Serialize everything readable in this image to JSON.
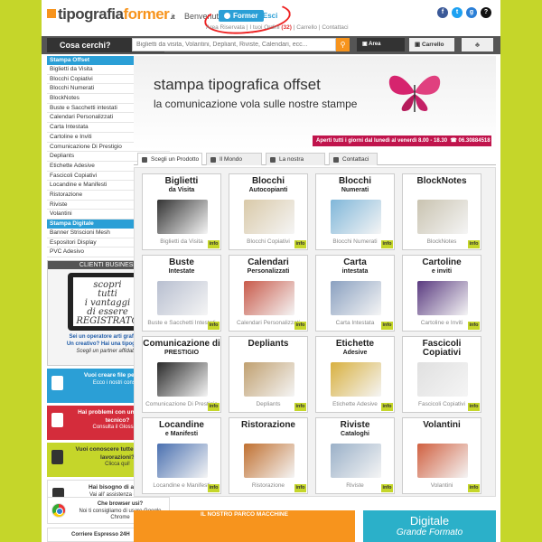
{
  "header": {
    "logo_main": "tipografia",
    "logo_accent": "former",
    "logo_tld": ".it",
    "welcome": "Benvenuto",
    "user": "Former",
    "logout": "- Esci",
    "subnav": [
      "Area Riservata",
      "I tuoi Ordini",
      "Carrello",
      "Contattaci"
    ],
    "orders_count": "(32)",
    "social": [
      {
        "name": "facebook-icon",
        "glyph": "f",
        "color": "#3b5998"
      },
      {
        "name": "twitter-icon",
        "glyph": "t",
        "color": "#1da1f2"
      },
      {
        "name": "gplus-icon",
        "glyph": "g",
        "color": "#2b7fd6"
      },
      {
        "name": "help-icon",
        "glyph": "?",
        "color": "#111111"
      }
    ]
  },
  "search": {
    "label": "Cosa cerchi?",
    "placeholder": "Biglietti da visita, Volantini, Depliant, Riviste, Calendari, ecc...",
    "area_riservata": "Area Riservata",
    "carrello": "Carrello"
  },
  "sidebar": {
    "offset_title": "Stampa Offset",
    "offset_items": [
      "Biglietti da Visita",
      "Blocchi Copiativi",
      "Blocchi Numerati",
      "BlockNotes",
      "Buste e Sacchetti intestati",
      "Calendari Personalizzati",
      "Carta Intestata",
      "Cartoline e Inviti",
      "Comunicazione Di Prestigio",
      "Depliants",
      "Etichette Adesive",
      "Fascicoli Copiativi",
      "Locandine e Manifesti",
      "Ristorazione",
      "Riviste",
      "Volantini"
    ],
    "digital_title": "Stampa Digitale",
    "digital_items": [
      "Banner Striscioni Mesh",
      "Espositori Display",
      "PVC Adesivo"
    ],
    "clienti": {
      "title": "CLIENTI BUSINESS",
      "tablet_text": [
        "scopri",
        "tutti",
        "i vantaggi",
        "di essere",
        "REGISTRATO"
      ],
      "text1": "Sei un operatore arti grafiche?",
      "text2": "Un creativo? Hai una tipografia?",
      "text3": "Scegli un partner affidabile"
    },
    "boxes": [
      {
        "name": "file-box",
        "title": "Vuoi creare file perfetti?",
        "sub": "Ecco i nostri consigli",
        "bg": "#2b9fd6",
        "icon_bg": "#ffffff"
      },
      {
        "name": "glossary-box",
        "title": "Hai problemi con un termine tecnico?",
        "sub": "Consulta il Glossario",
        "bg": "#d42c3b",
        "icon_bg": "#ffffff"
      },
      {
        "name": "processing-box",
        "title": "Vuoi conoscere tutte le nostre lavorazioni?",
        "sub": "Clicca qui!",
        "bg": "#c5d62a",
        "icon_bg": "#333333"
      },
      {
        "name": "assistance-box",
        "title": "Hai bisogno di aiuto?",
        "sub": "Vai all' assistenza clienti",
        "bg": "#ffffff",
        "icon_bg": "#333333"
      }
    ],
    "browser": {
      "title": "Che browser usi?",
      "sub": "Noi ti consigliamo di usare Google Chrome"
    },
    "corriere": "Corriere Espresso 24H"
  },
  "banner": {
    "title": "stampa tipografica offset",
    "subtitle": "la comunicazione vola sulle nostre stampe",
    "hours": "Aperti tutti i giorni dal lunedì al venerdì 8.00 - 18.30",
    "phone": "06.30884518"
  },
  "tabs": [
    "Scegli un Prodotto",
    "Il Mondo Former",
    "La nostra Azienda",
    "Contattaci"
  ],
  "products": [
    {
      "t1": "Biglietti",
      "t2": "da Visita",
      "cap": "Biglietti da Visita",
      "color": "#333333"
    },
    {
      "t1": "Blocchi",
      "t2": "Autocopianti",
      "cap": "Blocchi Copiativi",
      "color": "#d9c9a8"
    },
    {
      "t1": "Blocchi",
      "t2": "Numerati",
      "cap": "Blocchi Numerati",
      "color": "#7fb6d9"
    },
    {
      "t1": "BlockNotes",
      "t2": "",
      "cap": "BlockNotes",
      "color": "#c9c3b0"
    },
    {
      "t1": "Buste",
      "t2": "Intestate",
      "cap": "Buste e Sacchetti Intestati",
      "color": "#b8bfd0"
    },
    {
      "t1": "Calendari",
      "t2": "Personalizzati",
      "cap": "Calendari Personalizzati",
      "color": "#c85a4a"
    },
    {
      "t1": "Carta",
      "t2": "intestata",
      "cap": "Carta Intestata",
      "color": "#8aa0c0"
    },
    {
      "t1": "Cartoline",
      "t2": "e inviti",
      "cap": "Cartoline e Inviti",
      "color": "#5a3a80"
    },
    {
      "t1": "Comunicazione di",
      "t2": "PRESTIGIO",
      "cap": "Comunicazione Di Prestigio",
      "color": "#2a2a2a"
    },
    {
      "t1": "Depliants",
      "t2": "",
      "cap": "Depliants",
      "color": "#c0a070"
    },
    {
      "t1": "Etichette",
      "t2": "Adesive",
      "cap": "Etichette Adesive",
      "color": "#d8b040"
    },
    {
      "t1": "Fascicoli Copiativi",
      "t2": "",
      "cap": "Fascicoli Copiativi",
      "color": "#e0e0e0"
    },
    {
      "t1": "Locandine",
      "t2": "e Manifesti",
      "cap": "Locandine e Manifesti",
      "color": "#4a70b0"
    },
    {
      "t1": "Ristorazione",
      "t2": "",
      "cap": "Ristorazione",
      "color": "#c07030"
    },
    {
      "t1": "Riviste",
      "t2": "Cataloghi",
      "cap": "Riviste",
      "color": "#9ab0c8"
    },
    {
      "t1": "Volantini",
      "t2": "",
      "cap": "Volantini",
      "color": "#d06040"
    }
  ],
  "info_label": "info",
  "parco": "IL NOSTRO PARCO MACCHINE",
  "digitale": {
    "line1": "Digitale",
    "line2": "Grande Formato"
  }
}
